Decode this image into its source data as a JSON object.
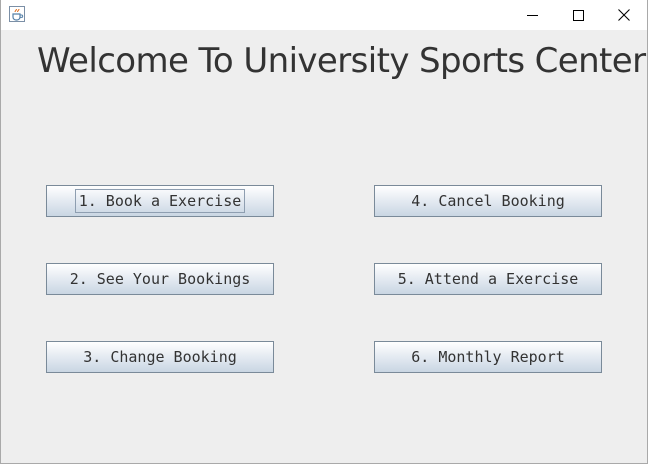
{
  "window": {
    "icon": "java-cup-icon",
    "controls": {
      "minimize": "minimize-icon",
      "maximize": "maximize-icon",
      "close": "close-icon"
    }
  },
  "heading": "Welcome  To University Sports Center",
  "buttons": {
    "book_exercise": "1. Book a Exercise",
    "see_bookings": "2. See Your Bookings",
    "change_booking": "3. Change Booking",
    "cancel_booking": "4. Cancel Booking",
    "attend_exercise": "5. Attend a Exercise",
    "monthly_report": "6. Monthly Report"
  },
  "colors": {
    "background": "#eeeeee",
    "titlebar": "#ffffff",
    "button_border": "#7a8a99",
    "text": "#333333"
  }
}
